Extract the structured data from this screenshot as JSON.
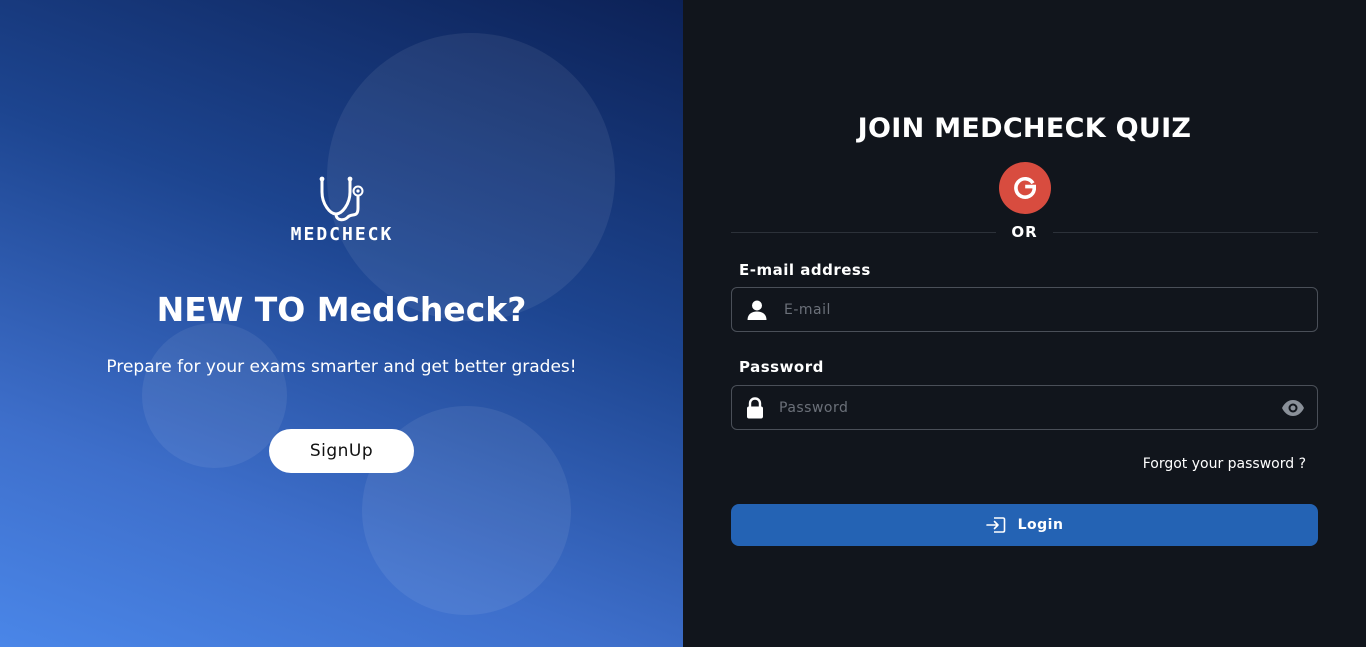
{
  "hero": {
    "brand_name": "MEDCHECK",
    "headline": "NEW TO MedCheck?",
    "tagline": "Prepare for your exams smarter and get better grades!",
    "signup_label": "SignUp"
  },
  "form": {
    "title": "JOIN MEDCHECK QUIZ",
    "google_letter": "G",
    "divider_text": "OR",
    "email": {
      "label": "E-mail address",
      "placeholder": "E-mail",
      "value": ""
    },
    "password": {
      "label": "Password",
      "placeholder": "Password",
      "value": ""
    },
    "forgot_label": "Forgot your password ?",
    "login_label": "Login"
  },
  "icons": {
    "logo": "stethoscope-icon",
    "google": "google-icon",
    "email": "user-icon",
    "password": "lock-icon",
    "visibility": "eye-icon",
    "login": "sign-in-icon"
  },
  "colors": {
    "hero_gradient_top": "#0c2156",
    "hero_gradient_bottom": "#4a86e8",
    "panel_background": "#11151c",
    "google_button": "#d84c3f",
    "login_button": "#2463b4"
  }
}
